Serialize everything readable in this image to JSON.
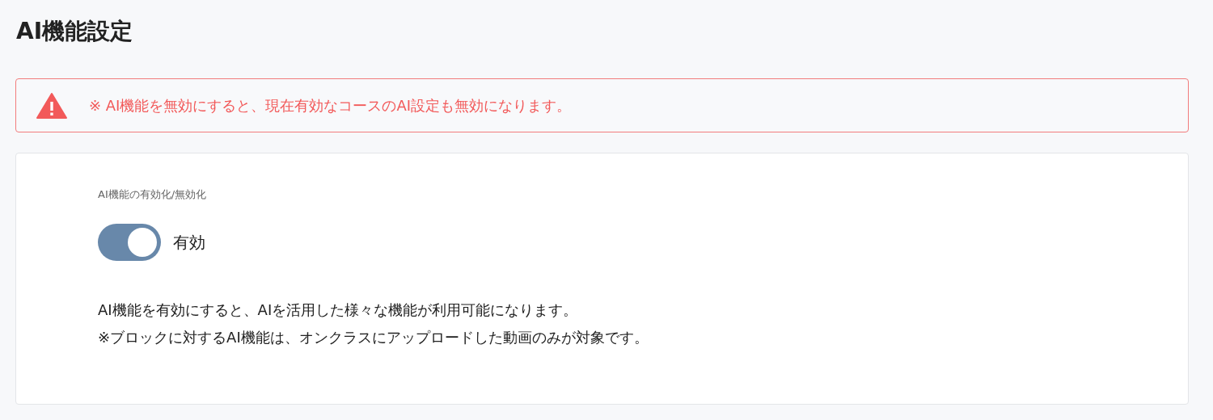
{
  "page": {
    "title": "AI機能設定"
  },
  "alert": {
    "text": "※ AI機能を無効にすると、現在有効なコースのAI設定も無効になります。"
  },
  "setting": {
    "label": "AI機能の有効化/無効化",
    "toggle": {
      "on": true,
      "label": "有効"
    },
    "description": [
      "AI機能を有効にすると、AIを活用した様々な機能が利用可能になります。",
      "※ブロックに対するAI機能は、オンクラスにアップロードした動画のみが対象です。"
    ]
  }
}
